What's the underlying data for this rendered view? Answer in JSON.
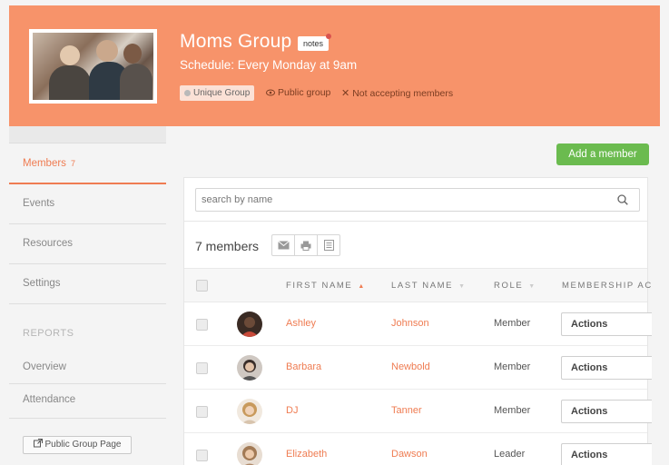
{
  "header": {
    "title": "Moms Group",
    "notes_badge": "notes",
    "schedule": "Schedule: Every Monday at 9am",
    "tag_unique": "Unique Group",
    "tag_public": "Public group",
    "tag_not_accepting": "Not accepting members",
    "colors": {
      "banner": "#f7936a",
      "accent": "#ef7c52",
      "add_button": "#6bbb4f"
    }
  },
  "sidebar": {
    "members_label": "Members",
    "members_count": "7",
    "events_label": "Events",
    "resources_label": "Resources",
    "settings_label": "Settings",
    "reports_heading": "REPORTS",
    "overview_label": "Overview",
    "attendance_label": "Attendance",
    "public_page_button": "Public Group Page"
  },
  "toolbar": {
    "add_member_label": "Add a member",
    "search_placeholder": "search by name",
    "members_count_label": "7 members",
    "icons": [
      "envelope-icon",
      "printer-icon",
      "spreadsheet-icon"
    ]
  },
  "table": {
    "columns": [
      "FIRST NAME",
      "LAST NAME",
      "ROLE",
      "MEMBERSHIP AC"
    ],
    "sorted_column": "FIRST NAME",
    "rows": [
      {
        "first": "Ashley",
        "last": "Johnson",
        "role": "Member",
        "action": "Actions"
      },
      {
        "first": "Barbara",
        "last": "Newbold",
        "role": "Member",
        "action": "Actions"
      },
      {
        "first": "DJ",
        "last": "Tanner",
        "role": "Member",
        "action": "Actions"
      },
      {
        "first": "Elizabeth",
        "last": "Dawson",
        "role": "Leader",
        "action": "Actions"
      }
    ]
  }
}
